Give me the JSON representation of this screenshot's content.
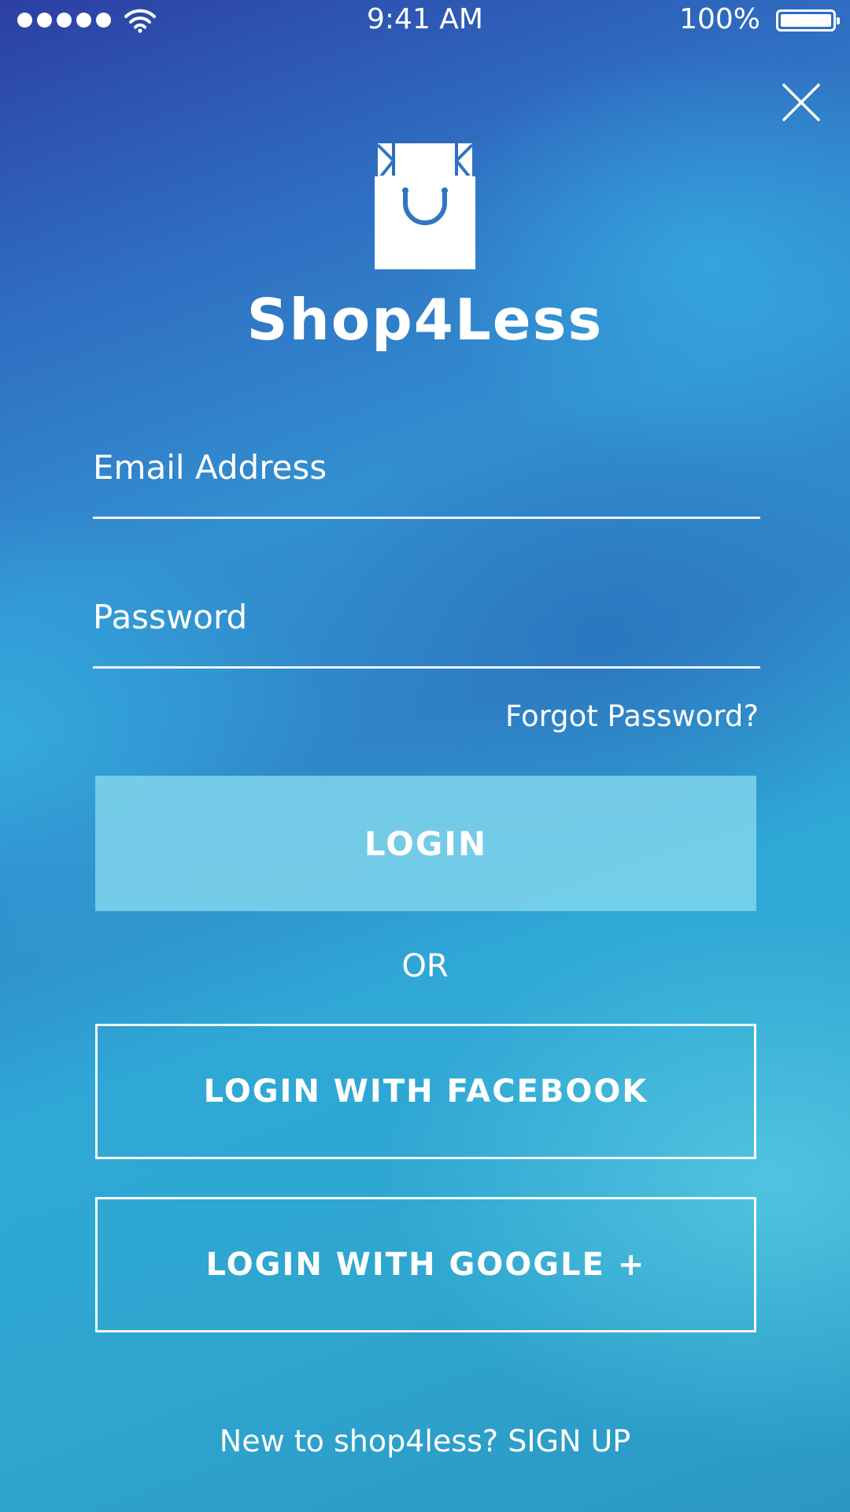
{
  "status_bar": {
    "time": "9:41 AM",
    "battery_percent": "100%",
    "signal_bars": 5,
    "icons": [
      "signal-dots-icon",
      "wifi-icon",
      "battery-icon"
    ]
  },
  "header": {
    "close_icon": "close-icon",
    "logo_icon": "shopping-bag-icon",
    "app_title": "Shop4Less"
  },
  "form": {
    "email_placeholder": "Email Address",
    "password_placeholder": "Password",
    "forgot_password": "Forgot Password?"
  },
  "actions": {
    "login_label": "LOGIN",
    "or_label": "OR",
    "facebook_label": "LOGIN WITH FACEBOOK",
    "google_label": "LOGIN WITH GOOGLE +"
  },
  "footer": {
    "prompt": "New to shop4less?",
    "signup_label": "SIGN UP"
  },
  "colors": {
    "text": "#ffffff",
    "gradient_top": "#2c3fa3",
    "gradient_bottom": "#2b97c4",
    "login_button": "#82d7eb",
    "logo_accent": "#2f75c4"
  }
}
